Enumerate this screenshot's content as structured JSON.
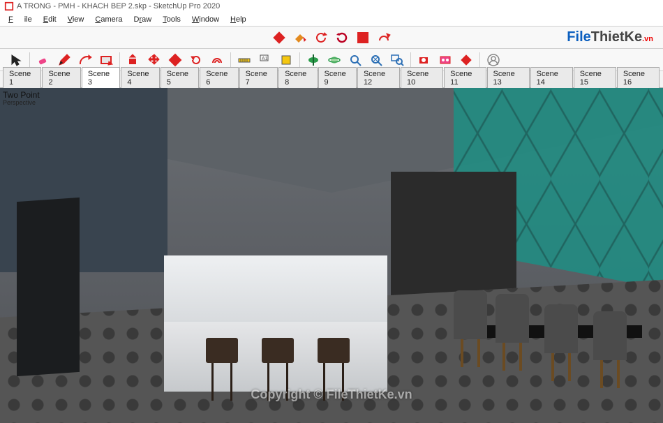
{
  "title": "A TRONG - PMH - KHACH BEP 2.skp - SketchUp Pro 2020",
  "menu": {
    "file": "File",
    "edit": "Edit",
    "view": "View",
    "camera": "Camera",
    "draw": "Draw",
    "tools": "Tools",
    "window": "Window",
    "help": "Help"
  },
  "toolbar1_icons": [
    "component",
    "paint",
    "rotate-green",
    "rotate-red",
    "explode",
    "explode-arrow"
  ],
  "toolbar2_icons": [
    "select",
    "eraser",
    "pencil",
    "arc",
    "rectangle",
    "pushpull",
    "move",
    "rotate",
    "scale",
    "followme",
    "offset",
    "tape",
    "text",
    "dimension",
    "section",
    "orbit",
    "pan",
    "zoom",
    "zoom-extents",
    "zoom-window",
    "position-camera",
    "look-around",
    "walk",
    "user"
  ],
  "scene_tabs": [
    "Scene 1",
    "Scene 2",
    "Scene 3",
    "Scene 4",
    "Scene 5",
    "Scene 6",
    "Scene 7",
    "Scene 8",
    "Scene 9",
    "Scene 12",
    "Scene 10",
    "Scene 11",
    "Scene 13",
    "Scene 14",
    "Scene 15",
    "Scene 16"
  ],
  "active_scene_index": 2,
  "viewport": {
    "camera_label": "Two Point",
    "camera_sub": "Perspective"
  },
  "watermark": {
    "logo_a": "File",
    "logo_b": "ThietKe",
    "logo_c": ".vn",
    "copyright": "Copyright © FileThietKe.vn"
  }
}
